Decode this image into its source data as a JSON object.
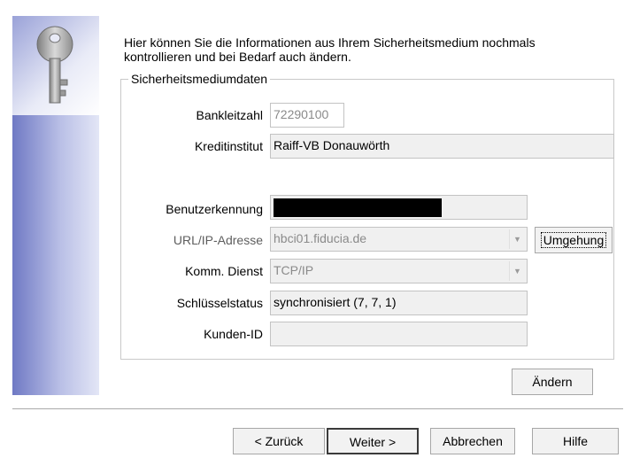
{
  "intro_text": "Hier können Sie die Informationen aus Ihrem Sicherheitsmedium nochmals kontrollieren und bei Bedarf auch ändern.",
  "group": {
    "title": "Sicherheitsmediumdaten",
    "fields": {
      "bankleitzahl": {
        "label": "Bankleitzahl",
        "value": "72290100"
      },
      "kreditinstitut": {
        "label": "Kreditinstitut",
        "value": "Raiff-VB Donauwörth"
      },
      "benutzerkennung": {
        "label": "Benutzerkennung",
        "value": ""
      },
      "url": {
        "label": "URL/IP-Adresse",
        "value": "hbci01.fiducia.de"
      },
      "komm_dienst": {
        "label": "Komm. Dienst",
        "value": "TCP/IP"
      },
      "schluesselstatus": {
        "label": "Schlüsselstatus",
        "value": "synchronisiert (7, 7, 1)"
      },
      "kunden_id": {
        "label": "Kunden-ID",
        "value": ""
      }
    },
    "umgehung_label": "Umgehung"
  },
  "aendern_label": "Ändern",
  "footer": {
    "back_label": "< Zurück",
    "next_label": "Weiter >",
    "cancel_label": "Abbrechen",
    "help_label": "Hilfe"
  },
  "icons": {
    "side_panel": "key-icon",
    "combo_arrow": "chevron-down-icon"
  },
  "colors": {
    "panel_dark": "#6f79c4",
    "panel_light": "#e3e6f6",
    "field_bg": "#f0f0f0"
  }
}
